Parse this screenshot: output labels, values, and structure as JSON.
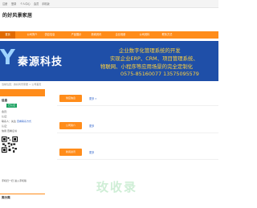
{
  "topbar": {
    "links": [
      "注册",
      "登录",
      "个人中心",
      "会员",
      "手机版"
    ]
  },
  "site": {
    "title": "的好风景家居"
  },
  "nav": {
    "items": [
      {
        "label": "首页",
        "active": true
      },
      {
        "label": "公司简介",
        "active": false
      },
      {
        "label": "供应信息",
        "active": false
      },
      {
        "label": "产品展示",
        "active": false
      },
      {
        "label": "新闻资讯",
        "active": false
      },
      {
        "label": "企业相册",
        "active": false
      },
      {
        "label": "公司资料",
        "active": false
      },
      {
        "label": "联系方式",
        "active": false
      }
    ]
  },
  "banner": {
    "brand": "秦源科技",
    "slogan1": "企业数字化管理系统的开发",
    "slogan2": "实现企业ERP、CRM、项目管理系统、",
    "slogan3": "物联网、小程序等应用场景的完全定制化",
    "phones": "0575-85160077 13575095579",
    "colors": {
      "background": "#1f4fa8",
      "slogan": "#ffd23d"
    }
  },
  "breadcrumb": "当前位置：的好风景家居 > 公司首页",
  "sidebar": {
    "title": "信息",
    "badge": "已认证",
    "lines": [
      "会员：",
      "认证：",
      "联系人：先生",
      "认证：",
      "信用 查看证书"
    ],
    "link_text": "查看联系方式",
    "note": "手机扫一扫 进入手机版",
    "title2": "类分类"
  },
  "sections": [
    {
      "button": "供应信息",
      "more": "更多 »"
    },
    {
      "button": "公司简介",
      "more": "更多"
    },
    {
      "button": "新闻资讯",
      "more": "更多"
    }
  ],
  "watermark": "玫收录",
  "colors": {
    "accent": "#ff8c1a",
    "badge": "#19a15f",
    "link": "#3366cc"
  }
}
